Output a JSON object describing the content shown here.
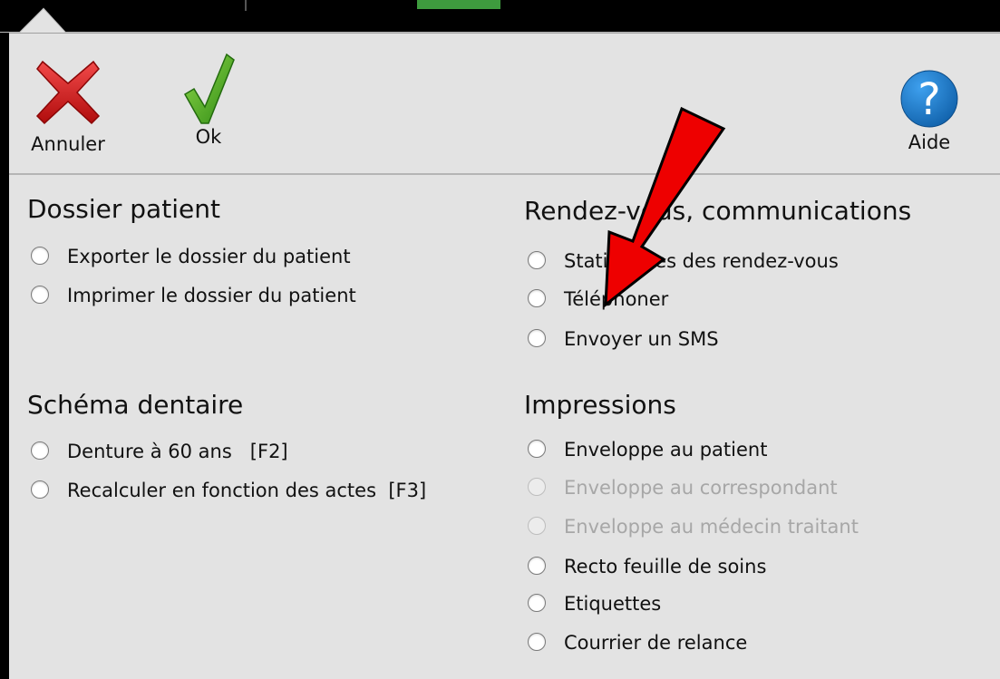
{
  "toolbar": {
    "cancel_label": "Annuler",
    "ok_label": "Ok",
    "help_label": "Aide"
  },
  "sections": {
    "patient_file": {
      "title": "Dossier patient",
      "items": [
        {
          "label": "Exporter le dossier du patient",
          "enabled": true
        },
        {
          "label": "Imprimer le dossier du patient",
          "enabled": true
        }
      ]
    },
    "appointments": {
      "title": "Rendez-vous, communications",
      "items": [
        {
          "label": "Statistiques des rendez-vous",
          "enabled": true
        },
        {
          "label": "Téléphoner",
          "enabled": true
        },
        {
          "label": "Envoyer un SMS",
          "enabled": true
        }
      ]
    },
    "dental_chart": {
      "title": "Schéma dentaire",
      "items": [
        {
          "label": "Denture à 60 ans   [F2]",
          "enabled": true
        },
        {
          "label": "Recalculer en fonction des actes  [F3]",
          "enabled": true
        }
      ]
    },
    "prints": {
      "title": "Impressions",
      "items": [
        {
          "label": "Enveloppe au patient",
          "enabled": true
        },
        {
          "label": "Enveloppe au correspondant",
          "enabled": false
        },
        {
          "label": "Enveloppe au médecin traitant",
          "enabled": false
        },
        {
          "label": "Recto feuille de soins",
          "enabled": true
        },
        {
          "label": "Etiquettes",
          "enabled": true
        },
        {
          "label": "Courrier de relance",
          "enabled": true
        }
      ]
    }
  },
  "colors": {
    "panel_bg": "#e3e3e3",
    "cancel_red": "#cc1111",
    "ok_green": "#4fae1f",
    "help_blue": "#1a78c8",
    "annotation_arrow": "#ee0000"
  }
}
